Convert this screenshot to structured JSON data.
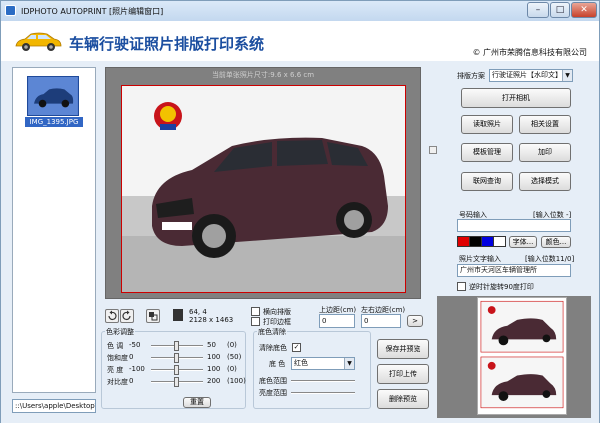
{
  "window": {
    "title": "IDPHOTO AUTOPRINT [照片编辑窗口]",
    "app_title": "车辆行驶证照片排版打印系统",
    "company": "© 广州市荣腾信息科技有限公司"
  },
  "thumbnail": {
    "caption": "IMG_1395.JPG"
  },
  "path": "::\\Users\\apple\\Desktop\\新建",
  "canvas": {
    "hint": "当前单张照片尺寸:9.6 x 6.6 cm"
  },
  "status": {
    "dpi": "64, 4",
    "dimensions": "2128 x 1463"
  },
  "options": {
    "landscape_label": "横向排版",
    "print_border_label": "打印边框",
    "top_margin_label": "上边距(cm)",
    "left_right_margin_label": "左右边距(cm)",
    "top_margin_value": "0",
    "left_right_margin_value": "0",
    "go_label": ">"
  },
  "color_adjust": {
    "group_title": "色彩调整",
    "rows": [
      {
        "label": "色 调",
        "min": "-50",
        "value": "50",
        "max": "(0)",
        "level": 0.5
      },
      {
        "label": "饱和度",
        "min": "0",
        "value": "100",
        "max": "(50)",
        "level": 0.5
      },
      {
        "label": "亮 度",
        "min": "-100",
        "value": "100",
        "max": "(0)",
        "level": 0.5
      },
      {
        "label": "对比度",
        "min": "0",
        "value": "200",
        "max": "(100)",
        "level": 0.5
      }
    ],
    "reset_label": "重置"
  },
  "bg_clean": {
    "group_title": "底色清除",
    "clear_label": "清除底色",
    "color_label": "底 色",
    "color_value": "红色",
    "range_label": "底色范围",
    "brightness_label": "亮度范围"
  },
  "actions": {
    "save_preview": "保存并预览",
    "print_upload": "打印上传",
    "delete_preview": "删除预览"
  },
  "right_panel": {
    "layout_scheme_label": "排版方案",
    "layout_scheme_value": "行驶证照片【水印文】",
    "open_camera": "打开相机",
    "read_photo": "读取照片",
    "settings": "相关设置",
    "template_manage": "模板管理",
    "watermark": "加印",
    "online_query": "联网查询",
    "select_mode": "选择模式",
    "plate_input_label": "号码输入",
    "plate_input_hint": "[输入位数 -]",
    "font_button": "字体...",
    "color_button": "颜色...",
    "photo_text_label": "照片文字输入",
    "photo_text_hint": "[输入位数11/0]",
    "photo_text_value": "广州市天河区车辆管理所",
    "rotate_print_label": "逆时针旋转90度打印"
  },
  "swatch_colors": [
    "#e00000",
    "#000000",
    "#0000e0",
    "#ffffff"
  ],
  "window_buttons": {
    "minimize": "–",
    "maximize": "□",
    "close": "✕"
  }
}
